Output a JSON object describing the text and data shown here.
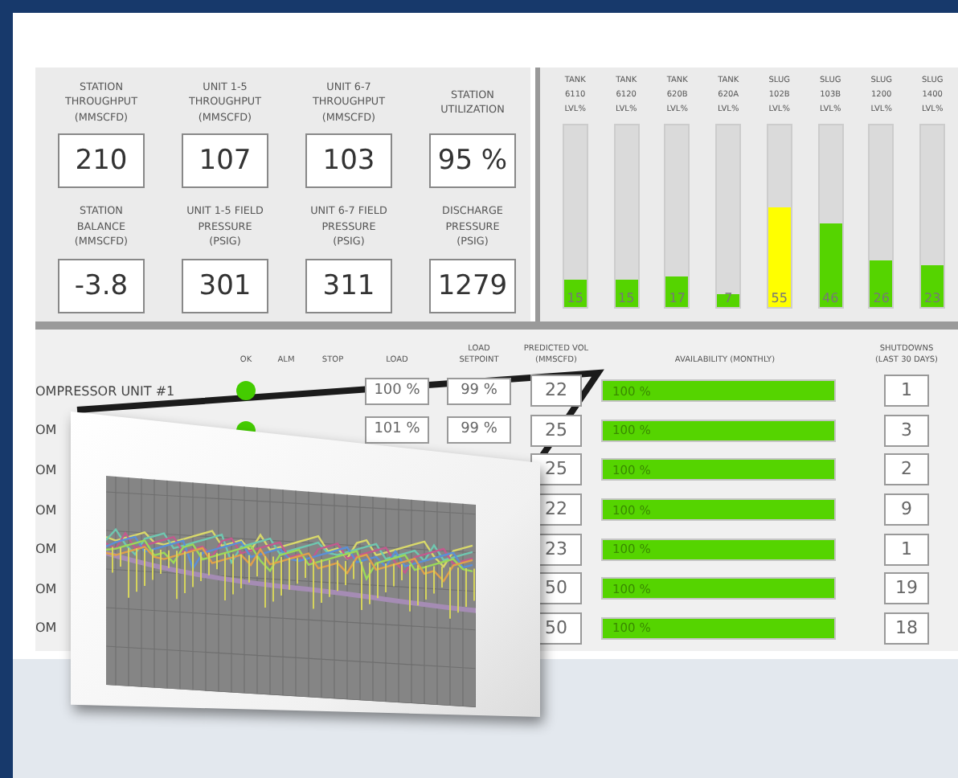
{
  "metrics": [
    {
      "label": "STATION\nTHROUGHPUT\n(MMSCFD)",
      "value": "210"
    },
    {
      "label": "UNIT 1-5\nTHROUGHPUT\n(MMSCFD)",
      "value": "107"
    },
    {
      "label": "UNIT 6-7\nTHROUGHPUT\n(MMSCFD)",
      "value": "103"
    },
    {
      "label": "STATION\nUTILIZATION",
      "value": "95 %"
    },
    {
      "label": "STATION\nBALANCE\n(MMSCFD)",
      "value": "-3.8"
    },
    {
      "label": "UNIT 1-5 FIELD\nPRESSURE\n(PSIG)",
      "value": "301"
    },
    {
      "label": "UNIT 6-7 FIELD\nPRESSURE\n(PSIG)",
      "value": "311"
    },
    {
      "label": "DISCHARGE\nPRESSURE\n(PSIG)",
      "value": "1279"
    }
  ],
  "tanks": [
    {
      "type": "TANK",
      "tag": "6110",
      "unit": "LVL%",
      "level": 0.15,
      "reading": "15",
      "color": "#55d400"
    },
    {
      "type": "TANK",
      "tag": "6120",
      "unit": "LVL%",
      "level": 0.15,
      "reading": "15",
      "color": "#55d400"
    },
    {
      "type": "TANK",
      "tag": "620B",
      "unit": "LVL%",
      "level": 0.17,
      "reading": "17",
      "color": "#55d400"
    },
    {
      "type": "TANK",
      "tag": "620A",
      "unit": "LVL%",
      "level": 0.07,
      "reading": "7",
      "color": "#55d400"
    },
    {
      "type": "SLUG",
      "tag": "102B",
      "unit": "LVL%",
      "level": 0.55,
      "reading": "55",
      "color": "#ffff00"
    },
    {
      "type": "SLUG",
      "tag": "103B",
      "unit": "LVL%",
      "level": 0.46,
      "reading": "46",
      "color": "#55d400"
    },
    {
      "type": "SLUG",
      "tag": "1200",
      "unit": "LVL%",
      "level": 0.26,
      "reading": "26",
      "color": "#55d400"
    },
    {
      "type": "SLUG",
      "tag": "1400",
      "unit": "LVL%",
      "level": 0.23,
      "reading": "23",
      "color": "#55d400"
    }
  ],
  "table": {
    "columns": [
      "OK",
      "ALM",
      "STOP",
      "LOAD",
      "LOAD\nSETPOINT",
      "PREDICTED VOL\n(MMSCFD)",
      "AVAILABILITY (MONTHLY)",
      "SHUTDOWNS\n(LAST 30 DAYS)"
    ],
    "rows": [
      {
        "name": "OMPRESSOR UNIT #1",
        "ok": true,
        "load": "100 %",
        "setpoint": "99 %",
        "predicted": "22",
        "availability": "100 %",
        "level": 1,
        "shutdowns": "1"
      },
      {
        "name": "OM",
        "ok": true,
        "load": "101 %",
        "setpoint": "99 %",
        "predicted": "25",
        "availability": "100 %",
        "level": 1,
        "shutdowns": "3"
      },
      {
        "name": "OM",
        "predicted": "25",
        "availability": "100 %",
        "level": 1,
        "shutdowns": "2"
      },
      {
        "name": "OM",
        "predicted": "22",
        "availability": "100 %",
        "level": 1,
        "shutdowns": "9"
      },
      {
        "name": "OM",
        "predicted": "23",
        "availability": "100 %",
        "level": 1,
        "shutdowns": "1"
      },
      {
        "name": "OM",
        "predicted": "50",
        "availability": "100 %",
        "level": 1,
        "shutdowns": "19"
      },
      {
        "name": "OM",
        "predicted": "50",
        "availability": "100 %",
        "level": 1,
        "shutdowns": "18"
      }
    ]
  }
}
